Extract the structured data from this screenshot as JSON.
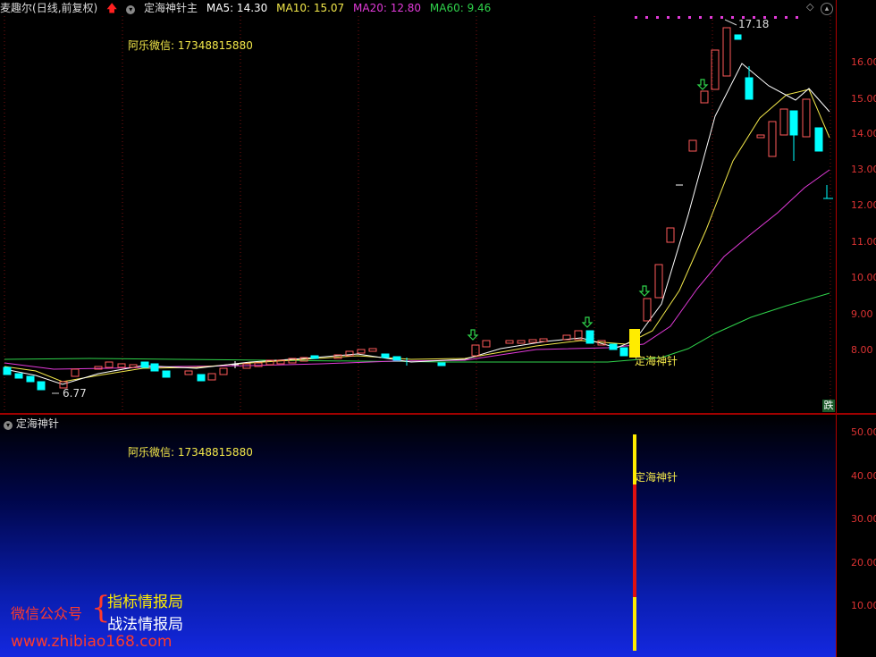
{
  "header": {
    "stock_name": "麦趣尔",
    "period": "(日线,前复权)",
    "indicator_name": "定海神针主",
    "ma5_label": "MA5: 14.30",
    "ma10_label": "MA10: 15.07",
    "ma20_label": "MA20: 12.80",
    "ma60_label": "MA60: 9.46",
    "colors": {
      "ma5": "#ffffff",
      "ma10": "#f3e84a",
      "ma20": "#e23ad9",
      "ma60": "#2fd34b"
    }
  },
  "main_chart": {
    "contact_text": "阿乐微信: 17348815880",
    "high_label": "17.18",
    "low_label": "6.77",
    "signal_label": "定海神针",
    "right_corner_label": "跌",
    "y_labels": [
      "16.00",
      "15.00",
      "14.00",
      "13.00",
      "12.00",
      "11.00",
      "10.00",
      "9.00",
      "8.00"
    ]
  },
  "sub_chart": {
    "title": "定海神针",
    "contact_text": "阿乐微信: 17348815880",
    "signal_label": "定海神针",
    "y_labels": [
      "50.00",
      "40.00",
      "30.00",
      "20.00",
      "10.00"
    ]
  },
  "promo": {
    "account_label": "微信公众号",
    "brace": "{",
    "name1": "指标情报局",
    "name2": "战法情报局",
    "website": "www.zhibiao168.com"
  }
}
